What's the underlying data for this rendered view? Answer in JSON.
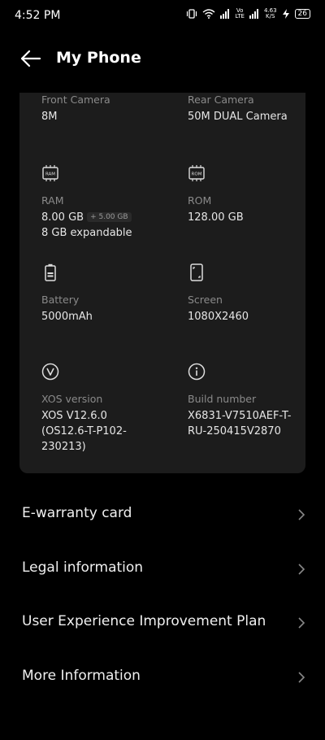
{
  "status_bar": {
    "time": "4:52 PM",
    "net_speed_top": "4.63",
    "net_speed_bottom": "K/S",
    "volte_top": "Vo",
    "volte_bottom": "LTE",
    "battery": "26"
  },
  "header": {
    "title": "My Phone"
  },
  "specs": {
    "front_camera": {
      "label": "Front Camera",
      "value": "8M"
    },
    "rear_camera": {
      "label": "Rear Camera",
      "value": "50M DUAL Camera"
    },
    "ram": {
      "icon_text": "RAM",
      "label": "RAM",
      "value": "8.00 GB",
      "extra": "+ 5.00 GB",
      "note": "8 GB expandable"
    },
    "rom": {
      "icon_text": "ROM",
      "label": "ROM",
      "value": "128.00 GB"
    },
    "battery": {
      "label": "Battery",
      "value": "5000mAh"
    },
    "screen": {
      "label": "Screen",
      "value": "1080X2460"
    },
    "xos": {
      "label": "XOS version",
      "value": "XOS V12.6.0 (OS12.6-T-P102-230213)"
    },
    "build": {
      "label": "Build number",
      "value": "X6831-V7510AEF-T-RU-250415V2870"
    }
  },
  "menu": [
    {
      "label": "E-warranty card"
    },
    {
      "label": "Legal information"
    },
    {
      "label": "User Experience Improvement Plan"
    },
    {
      "label": "More Information"
    }
  ]
}
